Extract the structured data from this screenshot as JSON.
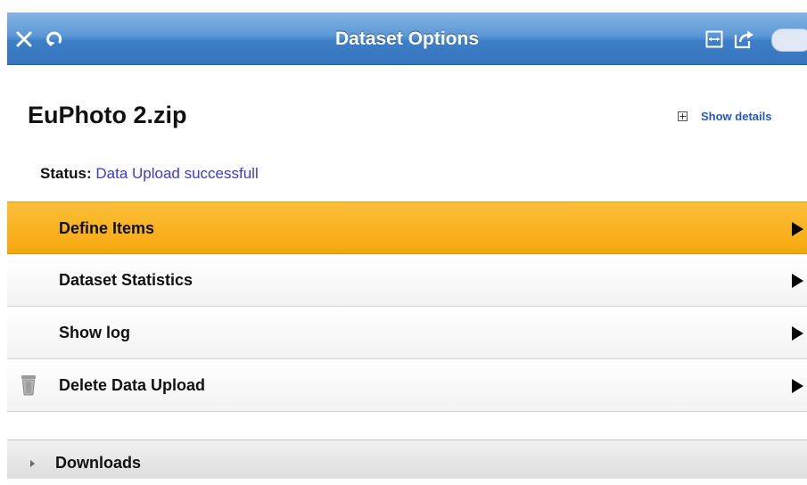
{
  "header": {
    "title": "Dataset Options",
    "icons": [
      "close-icon",
      "refresh-icon",
      "fit-width-icon",
      "share-icon"
    ],
    "colors": {
      "bar_top": "#86b6e6",
      "bar_bottom": "#3674bd"
    }
  },
  "dataset": {
    "name": "EuPhoto 2.zip",
    "show_details_label": "Show details",
    "status_label": "Status:",
    "status_value": "Data Upload successfull"
  },
  "menu": {
    "items": [
      {
        "label": "Define Items",
        "active": true,
        "icon": null
      },
      {
        "label": "Dataset Statistics",
        "active": false,
        "icon": null
      },
      {
        "label": "Show log",
        "active": false,
        "icon": null
      },
      {
        "label": "Delete Data Upload",
        "active": false,
        "icon": "trash-icon"
      }
    ],
    "colors": {
      "active": "#f6a80c",
      "status_link": "#3a3ad6",
      "details_link": "#2a56c6"
    }
  },
  "downloads": {
    "label": "Downloads"
  }
}
